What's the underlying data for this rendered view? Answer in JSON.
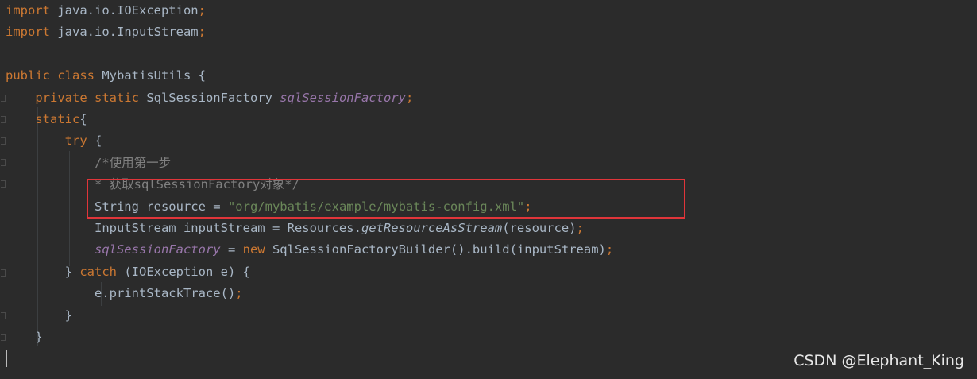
{
  "code_lines": [
    [
      {
        "t": "import",
        "c": "kw"
      },
      {
        "t": " java.io.IOException"
      },
      {
        "t": ";",
        "c": "kw"
      }
    ],
    [
      {
        "t": "import",
        "c": "kw"
      },
      {
        "t": " java.io.InputStream"
      },
      {
        "t": ";",
        "c": "kw"
      }
    ],
    [],
    [
      {
        "t": "public class",
        "c": "kw"
      },
      {
        "t": " MybatisUtils {"
      }
    ],
    [
      {
        "t": "    "
      },
      {
        "t": "private static",
        "c": "kw"
      },
      {
        "t": " SqlSessionFactory "
      },
      {
        "t": "sqlSessionFactory",
        "c": "fld"
      },
      {
        "t": ";",
        "c": "kw"
      }
    ],
    [
      {
        "t": "    "
      },
      {
        "t": "static",
        "c": "kw"
      },
      {
        "t": "{"
      }
    ],
    [
      {
        "t": "        "
      },
      {
        "t": "try",
        "c": "kw"
      },
      {
        "t": " {"
      }
    ],
    [
      {
        "t": "            "
      },
      {
        "t": "/*使用第一步",
        "c": "cmt"
      }
    ],
    [
      {
        "t": "            "
      },
      {
        "t": "* 获取sqlSessionFactory对象*/",
        "c": "cmt"
      }
    ],
    [
      {
        "t": "            String resource = "
      },
      {
        "t": "\"org/mybatis/example/mybatis-config.xml\"",
        "c": "str"
      },
      {
        "t": ";",
        "c": "kw"
      }
    ],
    [
      {
        "t": "            InputStream inputStream = Resources."
      },
      {
        "t": "getResourceAsStream",
        "c": "mth"
      },
      {
        "t": "(resource)"
      },
      {
        "t": ";",
        "c": "kw"
      }
    ],
    [
      {
        "t": "            "
      },
      {
        "t": "sqlSessionFactory",
        "c": "fld"
      },
      {
        "t": " = "
      },
      {
        "t": "new",
        "c": "kw"
      },
      {
        "t": " SqlSessionFactoryBuilder().build(inputStream)"
      },
      {
        "t": ";",
        "c": "kw"
      }
    ],
    [
      {
        "t": "        } "
      },
      {
        "t": "catch",
        "c": "kw"
      },
      {
        "t": " (IOException e) {"
      }
    ],
    [
      {
        "t": "            e.printStackTrace()"
      },
      {
        "t": ";",
        "c": "kw"
      }
    ],
    [
      {
        "t": "        }"
      }
    ],
    [
      {
        "t": "    }"
      }
    ]
  ],
  "watermark": "CSDN @Elephant_King",
  "colors": {
    "background": "#2b2b2b",
    "keyword": "#cc7832",
    "default": "#a9b7c6",
    "field": "#9876aa",
    "string": "#6a8759",
    "comment": "#808080",
    "highlight_box": "#e0353a"
  }
}
